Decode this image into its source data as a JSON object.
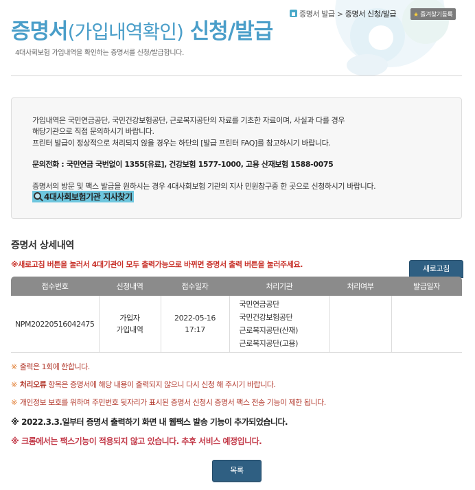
{
  "header": {
    "title_main": "증명서",
    "title_paren": "(가입내역확인)",
    "title_suffix": " 신청/발급",
    "subtitle": "4대사회보험 가입내역을 확인하는 증명서를 신청/발급합니다.",
    "breadcrumb": [
      "증명서 발급",
      "증명서 신청/발급"
    ],
    "favorite_label": "즐겨찾기등록"
  },
  "info": {
    "line1": "가입내역은 국민연금공단, 국민건강보험공단, 근로복지공단의 자료를 기초한 자료이며, 사실과 다를 경우",
    "line2": "해당기관으로 직접 문의하시기 바랍니다.",
    "line3": "프린터 발급이 정상적으로 처리되지 않을 경우는 하단의 [발급 프린터 FAQ]를 참고하시기 바랍니다.",
    "contact": "문의전화 : 국민연금 국번없이 1355[유료], 건강보험 1577-1000, 고용 산재보험 1588-0075",
    "visit": "증명서의 방문 및 팩스 발급을 원하시는 경우 4대사회보험 기관의 지사 민원창구중 한 곳으로 신청하시기 바랍니다.",
    "find_link": "4대사회보험기관 지사찾기"
  },
  "detail": {
    "title": "증명서 상세내역",
    "refresh_note": "※새로고침 버튼을 눌러서 4대기관이 모두 출력가능으로 바뀌면 증명서 출력 버튼을 눌러주세요.",
    "refresh_button": "새로고침",
    "columns": [
      "접수번호",
      "신청내역",
      "접수일자",
      "처리기관",
      "처리여부",
      "발급일자"
    ],
    "rows": [
      {
        "receipt_no": "NPM20220516042475",
        "request_1": "가입자",
        "request_2": "가입내역",
        "date": "2022-05-16",
        "time": "17:17",
        "orgs": [
          "국민연금공단",
          "국민건강보험공단",
          "근로복지공단(산재)",
          "근로복지공단(고용)"
        ],
        "status": "",
        "issue_date": ""
      }
    ]
  },
  "notes": {
    "marker": "※",
    "n1": "출력은 1회에 한합니다.",
    "n2_em": "처리오류",
    "n2_rest": " 항목은 증명서에 해당 내용이 출력되지 않으니 다시 신청 해 주시기 바랍니다.",
    "n3": "개인정보 보호를 위하여 주민번호 뒷자리가 표시된 증명서 신청시 증명서 팩스 전송 기능이 제한 됩니다.",
    "n4": "2022.3.3.일부터 증명서 출력하기 화면 내 웹팩스 발송 기능이 추가되었습니다.",
    "n5": "크롬에서는 팩스기능이 적용되지 않고 있습니다. 추후 서비스 예정입니다."
  },
  "list_button": "목록"
}
